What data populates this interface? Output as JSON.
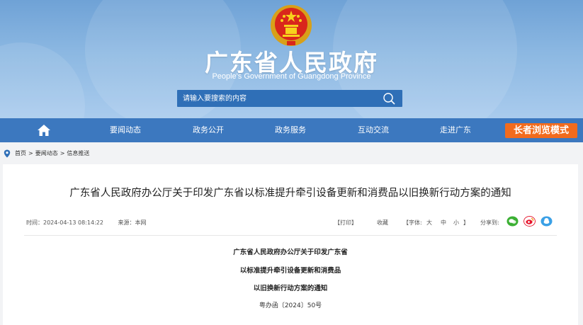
{
  "header": {
    "title": "广东省人民政府",
    "subtitle": "People's Government of Guangdong Province",
    "search_placeholder": "请输入要搜索的内容"
  },
  "nav": {
    "items": [
      "要闻动态",
      "政务公开",
      "政务服务",
      "互动交流",
      "走进广东"
    ],
    "elder_mode": "长者浏览模式"
  },
  "breadcrumb": {
    "home": "首页",
    "sep": ">",
    "level1": "要闻动态",
    "level2": "信息推送"
  },
  "article": {
    "title": "广东省人民政府办公厅关于印发广东省以标准提升牵引设备更新和消费品以旧换新行动方案的通知",
    "time": "时间：2024-04-13 08:14:22",
    "source": "来源：本网",
    "print": "【打印】",
    "favorite": "收藏",
    "font_label": "【字体:",
    "font_large": "大",
    "font_medium": "中",
    "font_small": "小",
    "font_close": "】",
    "share": "分享到:",
    "body_lines": [
      "广东省人民政府办公厅关于印发广东省",
      "以标准提升牵引设备更新和消费品",
      "以旧换新行动方案的通知"
    ],
    "doc_no": "粤办函〔2024〕50号"
  },
  "colors": {
    "nav": "#3c78bf",
    "search": "#2f6fb7",
    "elder": "#f26b1d",
    "wechat": "#3cb034",
    "weibo": "#e6162d",
    "qq": "#3aa0e6"
  }
}
